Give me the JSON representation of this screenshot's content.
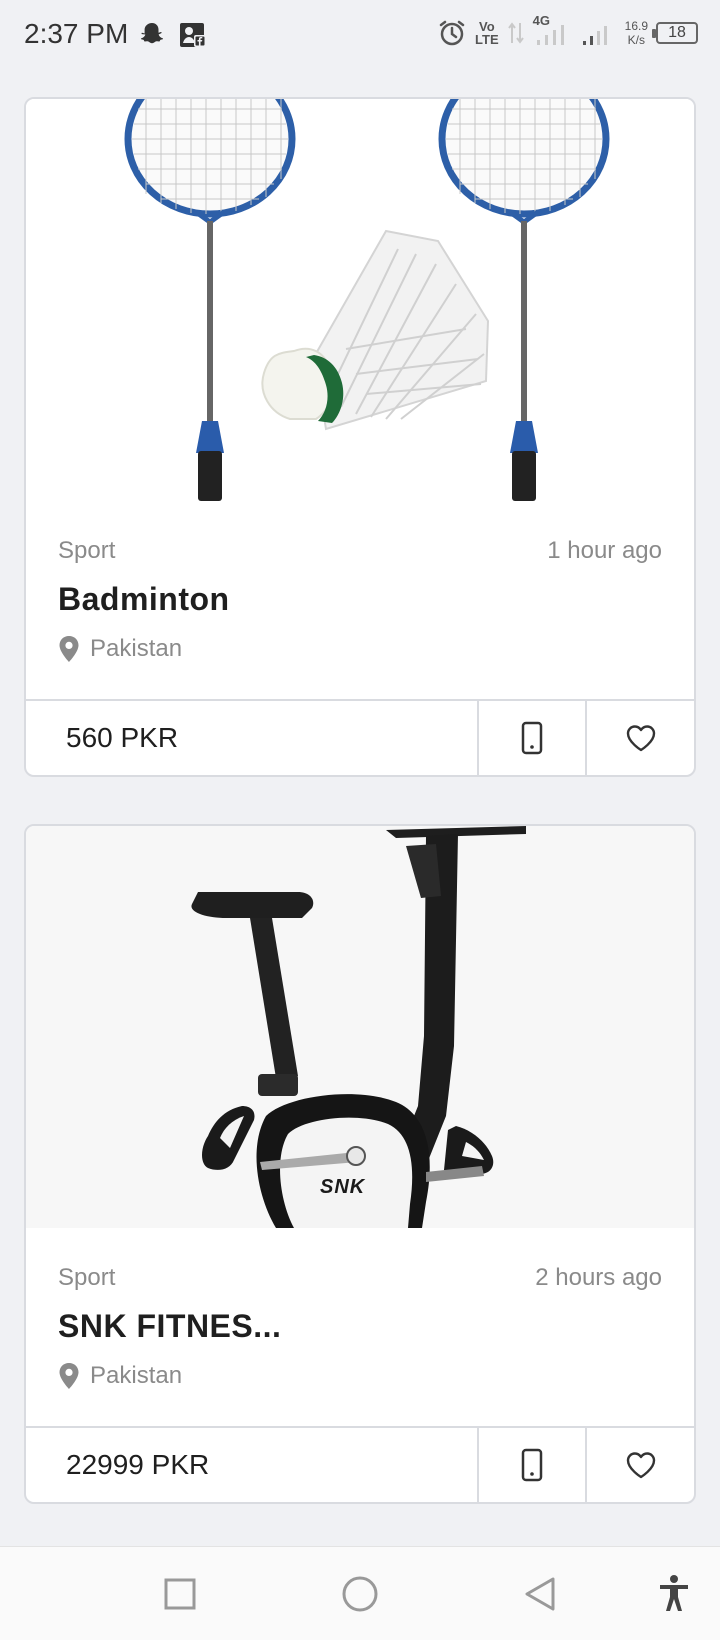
{
  "status_bar": {
    "time": "2:37 PM",
    "network_vo": "Vo",
    "network_lte": "LTE",
    "network_type": "4G",
    "speed_value": "16.9",
    "speed_unit": "K/s",
    "battery": "18"
  },
  "listings": [
    {
      "category": "Sport",
      "time_ago": "1 hour ago",
      "title": "Badminton",
      "location": "Pakistan",
      "price": "560 PKR"
    },
    {
      "category": "Sport",
      "time_ago": "2 hours ago",
      "title": "SNK FITNES...",
      "location": "Pakistan",
      "price": "22999 PKR",
      "image_brand_text": "SNK"
    }
  ],
  "icons": {
    "location": "location-pin-icon",
    "phone": "phone-icon",
    "favorite": "heart-icon",
    "nav_recent": "square-icon",
    "nav_home": "circle-icon",
    "nav_back": "triangle-back-icon",
    "nav_accessibility": "accessibility-icon"
  },
  "colors": {
    "background": "#f0f1f4",
    "card_border": "#d9dbe0",
    "muted_text": "#8a8a8a",
    "title_text": "#1f1f1f"
  }
}
